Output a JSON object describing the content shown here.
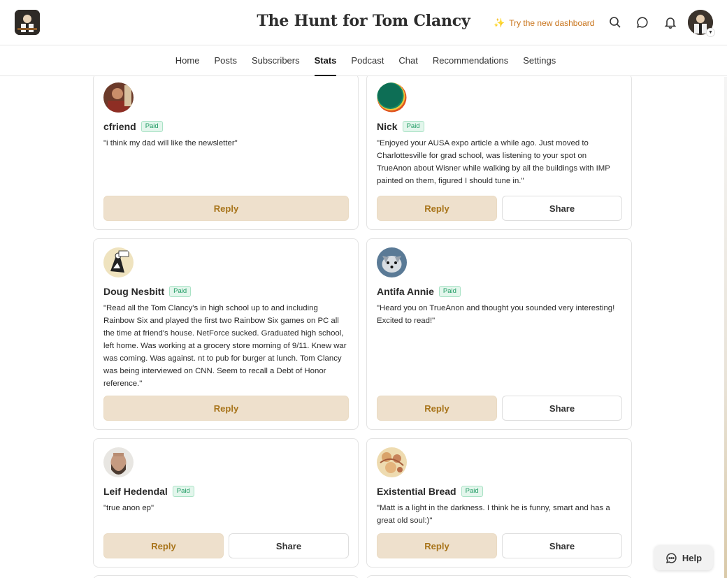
{
  "header": {
    "site_title": "The Hunt for Tom Clancy",
    "try_dashboard": "Try the new dashboard",
    "icons": [
      "search-icon",
      "chat-icon",
      "bell-icon"
    ]
  },
  "nav": {
    "items": [
      {
        "label": "Home"
      },
      {
        "label": "Posts"
      },
      {
        "label": "Subscribers"
      },
      {
        "label": "Stats",
        "active": true
      },
      {
        "label": "Podcast"
      },
      {
        "label": "Chat"
      },
      {
        "label": "Recommendations"
      },
      {
        "label": "Settings"
      }
    ]
  },
  "cards": [
    {
      "name": "cfriend",
      "badge": "Paid",
      "quote": "\"i think my dad will like the newsletter\"",
      "reply": "Reply"
    },
    {
      "name": "Nick",
      "badge": "Paid",
      "quote": "\"Enjoyed your AUSA expo article a while ago. Just moved to Charlottesville for grad school, was listening to your spot on TrueAnon about Wisner while walking by all the buildings with IMP painted on them, figured I should tune in.\"",
      "reply": "Reply",
      "share": "Share"
    },
    {
      "name": "Doug Nesbitt",
      "badge": "Paid",
      "quote": "\"Read all the Tom Clancy's in high school up to and including Rainbow Six and played the first two Rainbow Six games on PC all the time at friend's house. NetForce sucked. Graduated high school, left home. Was working at a grocery store morning of 9/11. Knew war was coming. Was against. nt to pub for burger at lunch. Tom Clancy was being interviewed on CNN. Seem to recall a Debt of Honor reference.\"",
      "reply": "Reply"
    },
    {
      "name": "Antifa Annie",
      "badge": "Paid",
      "quote": "\"Heard you on TrueAnon and thought you sounded very interesting! Excited to read!\"",
      "reply": "Reply",
      "share": "Share"
    },
    {
      "name": "Leif Hedendal",
      "badge": "Paid",
      "quote": "\"true anon ep\"",
      "reply": "Reply",
      "share": "Share"
    },
    {
      "name": "Existential Bread",
      "badge": "Paid",
      "quote": "\"Matt is a light in the darkness. I think he is funny, smart and has a great old soul:)\"",
      "reply": "Reply",
      "share": "Share"
    }
  ],
  "help": {
    "label": "Help"
  },
  "colors": {
    "accent": "#a8741a",
    "reply_bg": "#eee0cc",
    "paid_green": "#1e9a62",
    "try_dash": "#c8731a"
  }
}
